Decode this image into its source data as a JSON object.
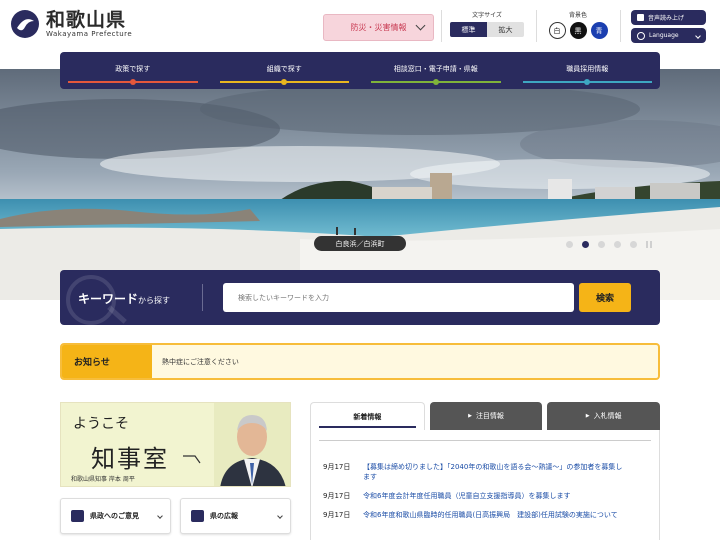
{
  "header": {
    "logo_title": "和歌山県",
    "logo_subtitle": "Wakayama Prefecture",
    "disaster_button": "防災・災害情報",
    "font_size": {
      "label": "文字サイズ",
      "standard": "標準",
      "large": "拡大"
    },
    "bg_color": {
      "label": "背景色",
      "white": "白",
      "black": "黒",
      "blue": "青"
    },
    "voice_read": "音声読み上げ",
    "language": "Language"
  },
  "nav": {
    "items": [
      {
        "label": "政策で探す",
        "color": "#e4573c"
      },
      {
        "label": "組織で探す",
        "color": "#e8b520"
      },
      {
        "label": "相談窓口・電子申請・県報",
        "color": "#7fb23a"
      },
      {
        "label": "職員採用情報",
        "color": "#3ea7c2"
      }
    ]
  },
  "hero": {
    "caption": "白良浜／白浜町",
    "slide_total": 5,
    "slide_active": 2
  },
  "search": {
    "title_main": "キーワード",
    "title_sub": "から探す",
    "placeholder": "検索したいキーワードを入力",
    "button": "検索"
  },
  "notice": {
    "label": "お知らせ",
    "message": "熱中症にご注意ください"
  },
  "governor": {
    "welcome": "ようこそ",
    "office": "知事室",
    "name_line": "和歌山県知事 岸本 周平"
  },
  "quick_links": [
    {
      "label": "県政へのご意見"
    },
    {
      "label": "県の広報"
    }
  ],
  "tabs": [
    {
      "label": "新着情報",
      "active": true
    },
    {
      "label": "注目情報",
      "active": false
    },
    {
      "label": "入札情報",
      "active": false
    }
  ],
  "news": [
    {
      "date": "9月17日",
      "text": "【募集は締め切りました】「2040年の和歌山を語る会～熟議～」の参加者を募集します"
    },
    {
      "date": "9月17日",
      "text": "令和6年度会計年度任用職員（児童自立支援指導員）を募集します"
    },
    {
      "date": "9月17日",
      "text": "令和6年度和歌山県臨時的任用職員(日高振興局　建設部)任用試験の実施について"
    }
  ]
}
